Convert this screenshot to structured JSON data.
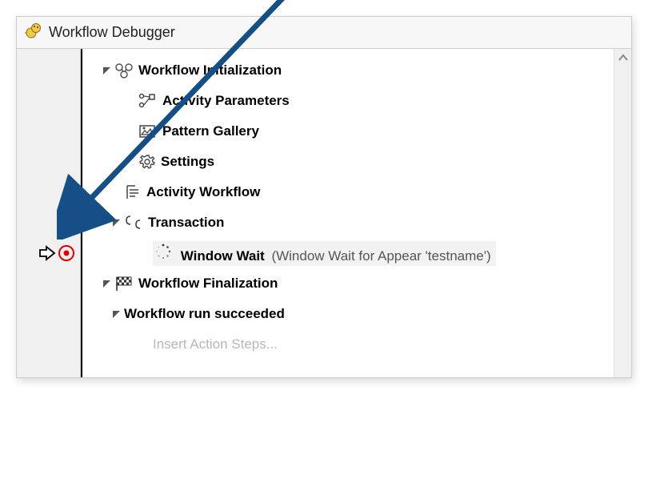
{
  "window": {
    "title": "Workflow Debugger"
  },
  "tree": {
    "init": {
      "label": "Workflow Initialization"
    },
    "params": {
      "label": "Activity Parameters"
    },
    "gallery": {
      "label": "Pattern Gallery"
    },
    "settings": {
      "label": "Settings"
    },
    "activityWorkflow": {
      "label": "Activity Workflow"
    },
    "transaction": {
      "label": "Transaction"
    },
    "windowWait": {
      "label": "Window Wait",
      "detail": "(Window Wait for Appear 'testname')"
    },
    "finalization": {
      "label": "Workflow Finalization"
    },
    "runStatus": {
      "label": "Workflow run succeeded"
    },
    "insertPlaceholder": {
      "label": "Insert Action Steps..."
    }
  },
  "icons": {
    "breakpoint": "breakpoint-icon",
    "currentLine": "current-line-arrow-icon"
  }
}
